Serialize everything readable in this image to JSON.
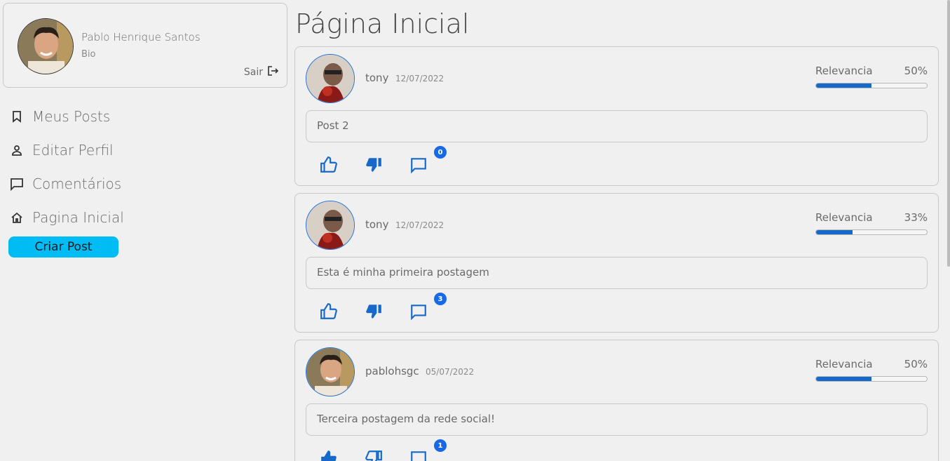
{
  "profile": {
    "name": "Pablo Henrique Santos",
    "bio": "Bio",
    "logout_label": "Sair"
  },
  "nav": {
    "items": [
      {
        "label": "Meus Posts",
        "icon": "bookmark-icon"
      },
      {
        "label": "Editar Perfil",
        "icon": "person-icon"
      },
      {
        "label": "Comentários",
        "icon": "comment-icon"
      },
      {
        "label": "Pagina Inicial",
        "icon": "home-icon"
      }
    ],
    "create_button": "Criar Post"
  },
  "page_title": "Página Inicial",
  "relevance_label": "Relevancia",
  "colors": {
    "accent": "#1769c9",
    "button": "#00bcf5",
    "badge": "#1769e6"
  },
  "posts": [
    {
      "user": "tony",
      "date": "12/07/2022",
      "relevance": "50%",
      "relevance_fraction": 0.5,
      "body": "Post 2",
      "comments": "0"
    },
    {
      "user": "tony",
      "date": "12/07/2022",
      "relevance": "33%",
      "relevance_fraction": 0.33,
      "body": "Esta é minha primeira postagem",
      "comments": "3"
    },
    {
      "user": "pablohsgc",
      "date": "05/07/2022",
      "relevance": "50%",
      "relevance_fraction": 0.5,
      "body": "Terceira postagem da rede social!",
      "comments": "1"
    }
  ]
}
